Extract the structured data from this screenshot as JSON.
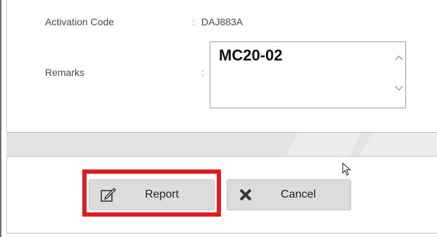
{
  "form": {
    "activation_code_label": "Activation Code",
    "activation_code_colon": ":",
    "activation_code_value": "DAJ883A",
    "remarks_label": "Remarks",
    "remarks_colon": ":",
    "remarks_value": "MC20-02"
  },
  "buttons": {
    "report_label": "Report",
    "cancel_label": "Cancel"
  },
  "colors": {
    "highlight": "#e31b1b",
    "button_bg": "#dcdcdc"
  }
}
